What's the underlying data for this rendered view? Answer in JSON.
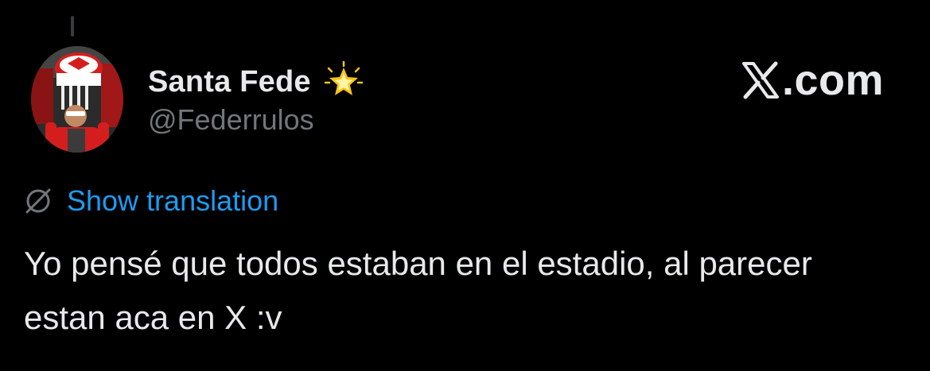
{
  "tweet": {
    "display_name": "Santa Fede",
    "handle": "@Federrulos",
    "brand": ".com",
    "translate_label": "Show translation",
    "text": "Yo pensé que todos estaban en el estadio, al parecer estan aca en X :v"
  },
  "icons": {
    "name_badge": "glowing-star-icon",
    "translate": "no-translation-globe-icon",
    "brand": "x-logo-icon"
  },
  "colors": {
    "background": "#000000",
    "primary_text": "#e7e9ea",
    "secondary_text": "#71767b",
    "link": "#1d9bf0",
    "star": "#f5c518"
  }
}
